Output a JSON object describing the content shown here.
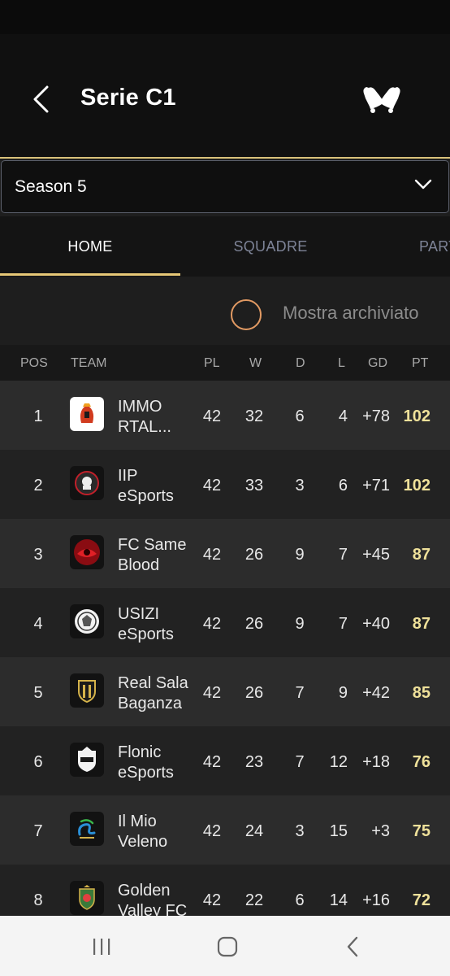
{
  "header": {
    "title": "Serie C1"
  },
  "season": {
    "selected": "Season 5"
  },
  "tabs": [
    {
      "label": "HOME",
      "active": true
    },
    {
      "label": "SQUADRE",
      "active": false
    },
    {
      "label": "PART",
      "active": false
    }
  ],
  "archive": {
    "label": "Mostra archiviato",
    "checked": false
  },
  "table": {
    "columns": {
      "pos": "POS",
      "team": "TEAM",
      "pl": "PL",
      "w": "W",
      "d": "D",
      "l": "L",
      "gd": "GD",
      "pt": "PT"
    },
    "rows": [
      {
        "pos": "1",
        "team": "IMMO\nRTAL...",
        "pl": "42",
        "w": "32",
        "d": "6",
        "l": "4",
        "gd": "+78",
        "pt": "102"
      },
      {
        "pos": "2",
        "team": "IIP\neSports",
        "pl": "42",
        "w": "33",
        "d": "3",
        "l": "6",
        "gd": "+71",
        "pt": "102"
      },
      {
        "pos": "3",
        "team": "FC Same\nBlood",
        "pl": "42",
        "w": "26",
        "d": "9",
        "l": "7",
        "gd": "+45",
        "pt": "87"
      },
      {
        "pos": "4",
        "team": "USIZI\neSports",
        "pl": "42",
        "w": "26",
        "d": "9",
        "l": "7",
        "gd": "+40",
        "pt": "87"
      },
      {
        "pos": "5",
        "team": "Real Sala\nBaganza",
        "pl": "42",
        "w": "26",
        "d": "7",
        "l": "9",
        "gd": "+42",
        "pt": "85"
      },
      {
        "pos": "6",
        "team": "Flonic\neSports",
        "pl": "42",
        "w": "23",
        "d": "7",
        "l": "12",
        "gd": "+18",
        "pt": "76"
      },
      {
        "pos": "7",
        "team": "Il Mio\nVeleno",
        "pl": "42",
        "w": "24",
        "d": "3",
        "l": "15",
        "gd": "+3",
        "pt": "75"
      },
      {
        "pos": "8",
        "team": "Golden\nValley FC",
        "pl": "42",
        "w": "22",
        "d": "6",
        "l": "14",
        "gd": "+16",
        "pt": "72"
      }
    ]
  },
  "colors": {
    "accent_gold": "#e6c877",
    "points": "#efe19a",
    "radio_ring": "#e29a63"
  }
}
